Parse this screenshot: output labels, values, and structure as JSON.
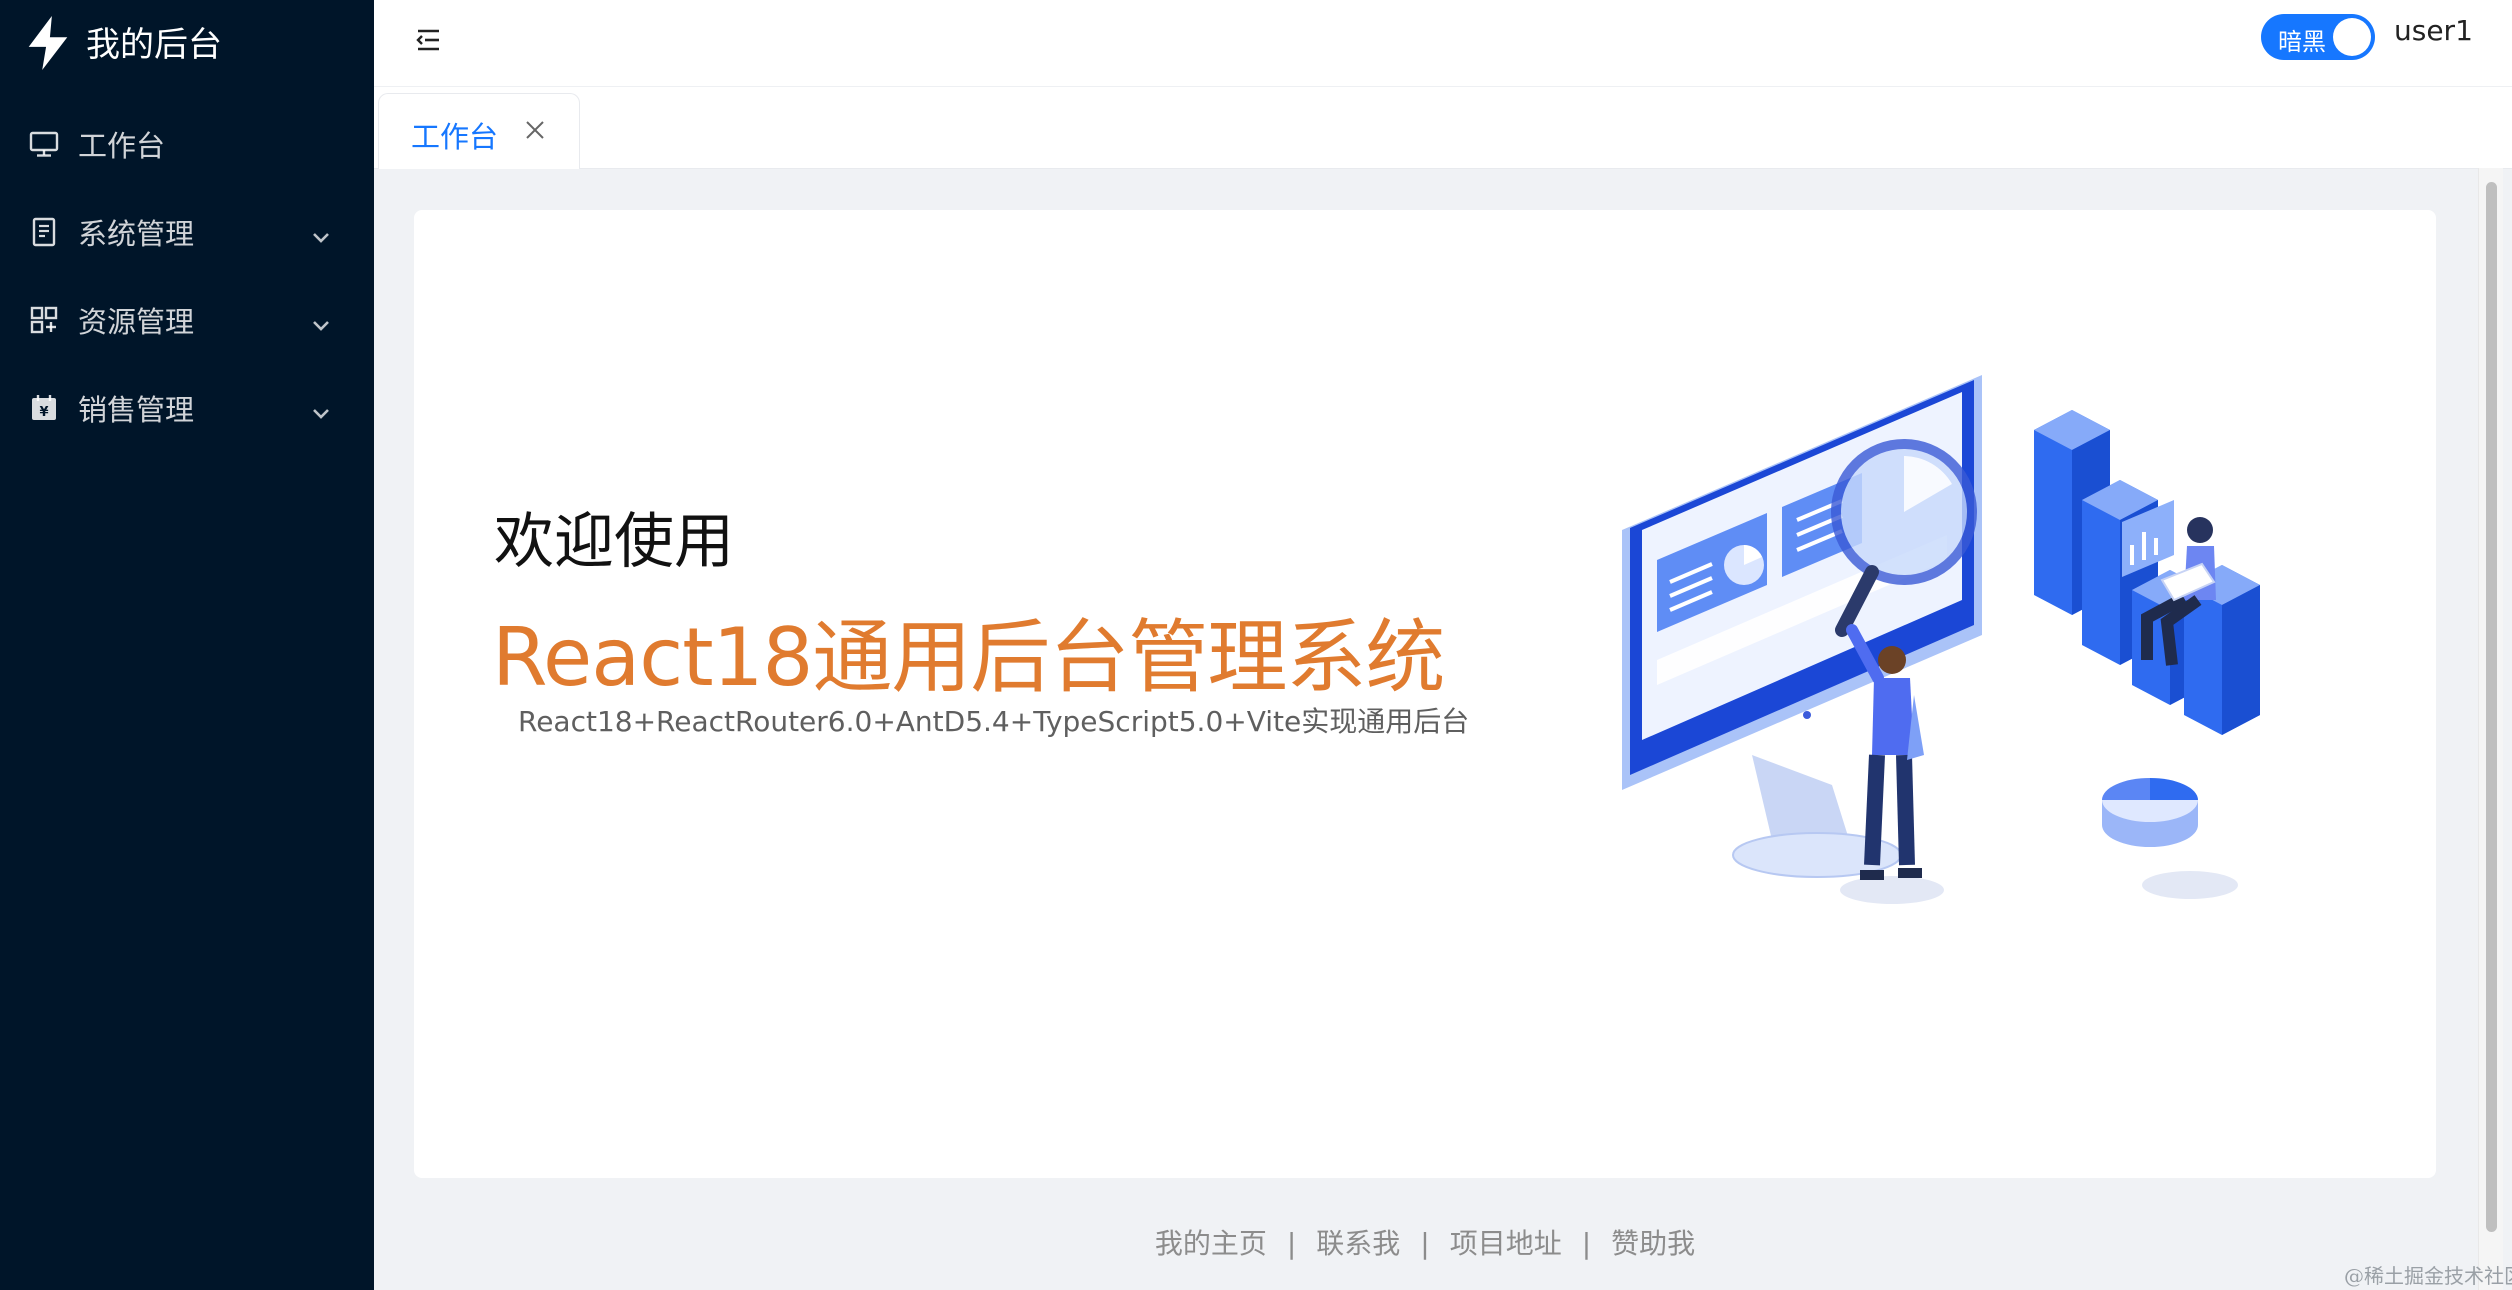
{
  "sidebar": {
    "logo_icon": "lightning-icon",
    "logo_text": "我的后台",
    "items": [
      {
        "label": "工作台",
        "icon": "desktop-icon",
        "has_submenu": false
      },
      {
        "label": "系统管理",
        "icon": "document-icon",
        "has_submenu": true
      },
      {
        "label": "资源管理",
        "icon": "appstore-icon",
        "has_submenu": true
      },
      {
        "label": "销售管理",
        "icon": "wallet-icon",
        "has_submenu": true
      }
    ]
  },
  "header": {
    "collapse_icon": "menu-fold-icon",
    "theme_switch_label": "暗黑",
    "theme_switch_on": true,
    "username": "user1"
  },
  "tabs": [
    {
      "label": "工作台",
      "active": true
    }
  ],
  "welcome": {
    "greeting": "欢迎使用",
    "title": "React18通用后台管理系统",
    "subtitle": "React18+ReactRouter6.0+AntD5.4+TypeScript5.0+Vite实现通用后台"
  },
  "footer": {
    "links": [
      "我的主页",
      "联系我",
      "项目地址",
      "赞助我"
    ],
    "separator": "|"
  },
  "watermark": "@稀土掘金技术社区",
  "colors": {
    "sidebar_bg": "#001529",
    "accent": "#1677ff",
    "title_orange": "#e07b2f"
  }
}
